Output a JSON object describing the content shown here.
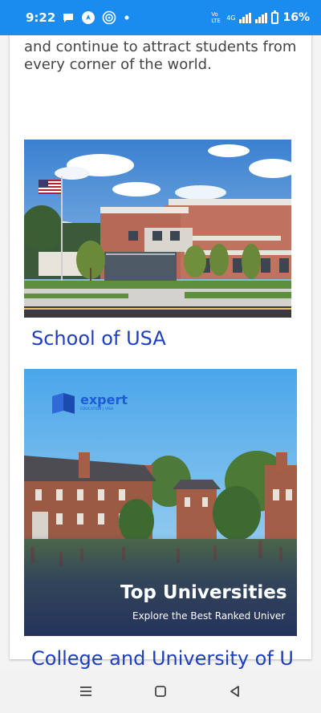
{
  "status": {
    "time": "9:22",
    "battery": "16%",
    "network_label": "4G",
    "volte_label": "Vo LTE"
  },
  "article": {
    "intro_text": "and continue to attract students from every corner of the world.",
    "items": [
      {
        "caption": "School of USA"
      },
      {
        "caption": "College and University of U",
        "banner": {
          "brand": "expert",
          "brand_sub": "EDUCATION | VISA",
          "headline": "Top Universities",
          "subline": "Explore the Best Ranked Univer"
        }
      }
    ]
  },
  "colors": {
    "status_bar": "#1a8cf0",
    "caption": "#1f3fbf",
    "banner_brand": "#1e5bd6"
  },
  "icons": [
    "chat-icon",
    "location-icon",
    "target-icon",
    "dot-icon",
    "signal-icon",
    "battery-icon",
    "menu-icon",
    "home-icon",
    "back-icon"
  ]
}
